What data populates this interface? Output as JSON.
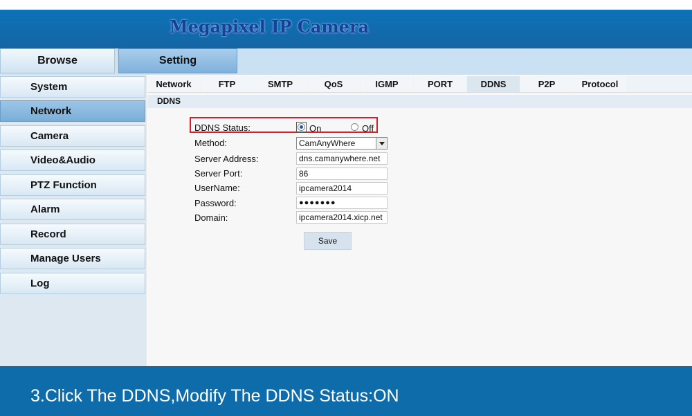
{
  "header": {
    "title": "Megapixel IP Camera"
  },
  "top_tabs": {
    "browse": "Browse",
    "setting": "Setting"
  },
  "sidebar": {
    "items": [
      {
        "label": "System"
      },
      {
        "label": "Network",
        "active": true
      },
      {
        "label": "Camera"
      },
      {
        "label": "Video&Audio"
      },
      {
        "label": "PTZ Function"
      },
      {
        "label": "Alarm"
      },
      {
        "label": "Record"
      },
      {
        "label": "Manage Users"
      },
      {
        "label": "Log"
      }
    ]
  },
  "subtabs": [
    "Network",
    "FTP",
    "SMTP",
    "QoS",
    "IGMP",
    "PORT",
    "DDNS",
    "P2P",
    "Protocol"
  ],
  "active_subtab": "DDNS",
  "section": {
    "title": "DDNS"
  },
  "form": {
    "status_label": "DDNS Status:",
    "status_on": "On",
    "status_off": "Off",
    "status_value": "On",
    "method_label": "Method:",
    "method_value": "CamAnyWhere",
    "server_address_label": "Server Address:",
    "server_address_value": "dns.camanywhere.net",
    "server_port_label": "Server Port:",
    "server_port_value": "86",
    "username_label": "UserName:",
    "username_value": "ipcamera2014",
    "password_label": "Password:",
    "password_value": "●●●●●●●",
    "domain_label": "Domain:",
    "domain_value": "ipcamera2014.xicp.net",
    "save_label": "Save"
  },
  "footer": {
    "caption": "3.Click The DDNS,Modify The DDNS Status:ON"
  },
  "colors": {
    "header_bg": "#0d72b8",
    "footer_bg": "#0e6cab",
    "highlight": "#d4202c",
    "active_tab": "#7fb1dc"
  },
  "icons": {
    "select_arrow": "triangle-down-icon"
  }
}
